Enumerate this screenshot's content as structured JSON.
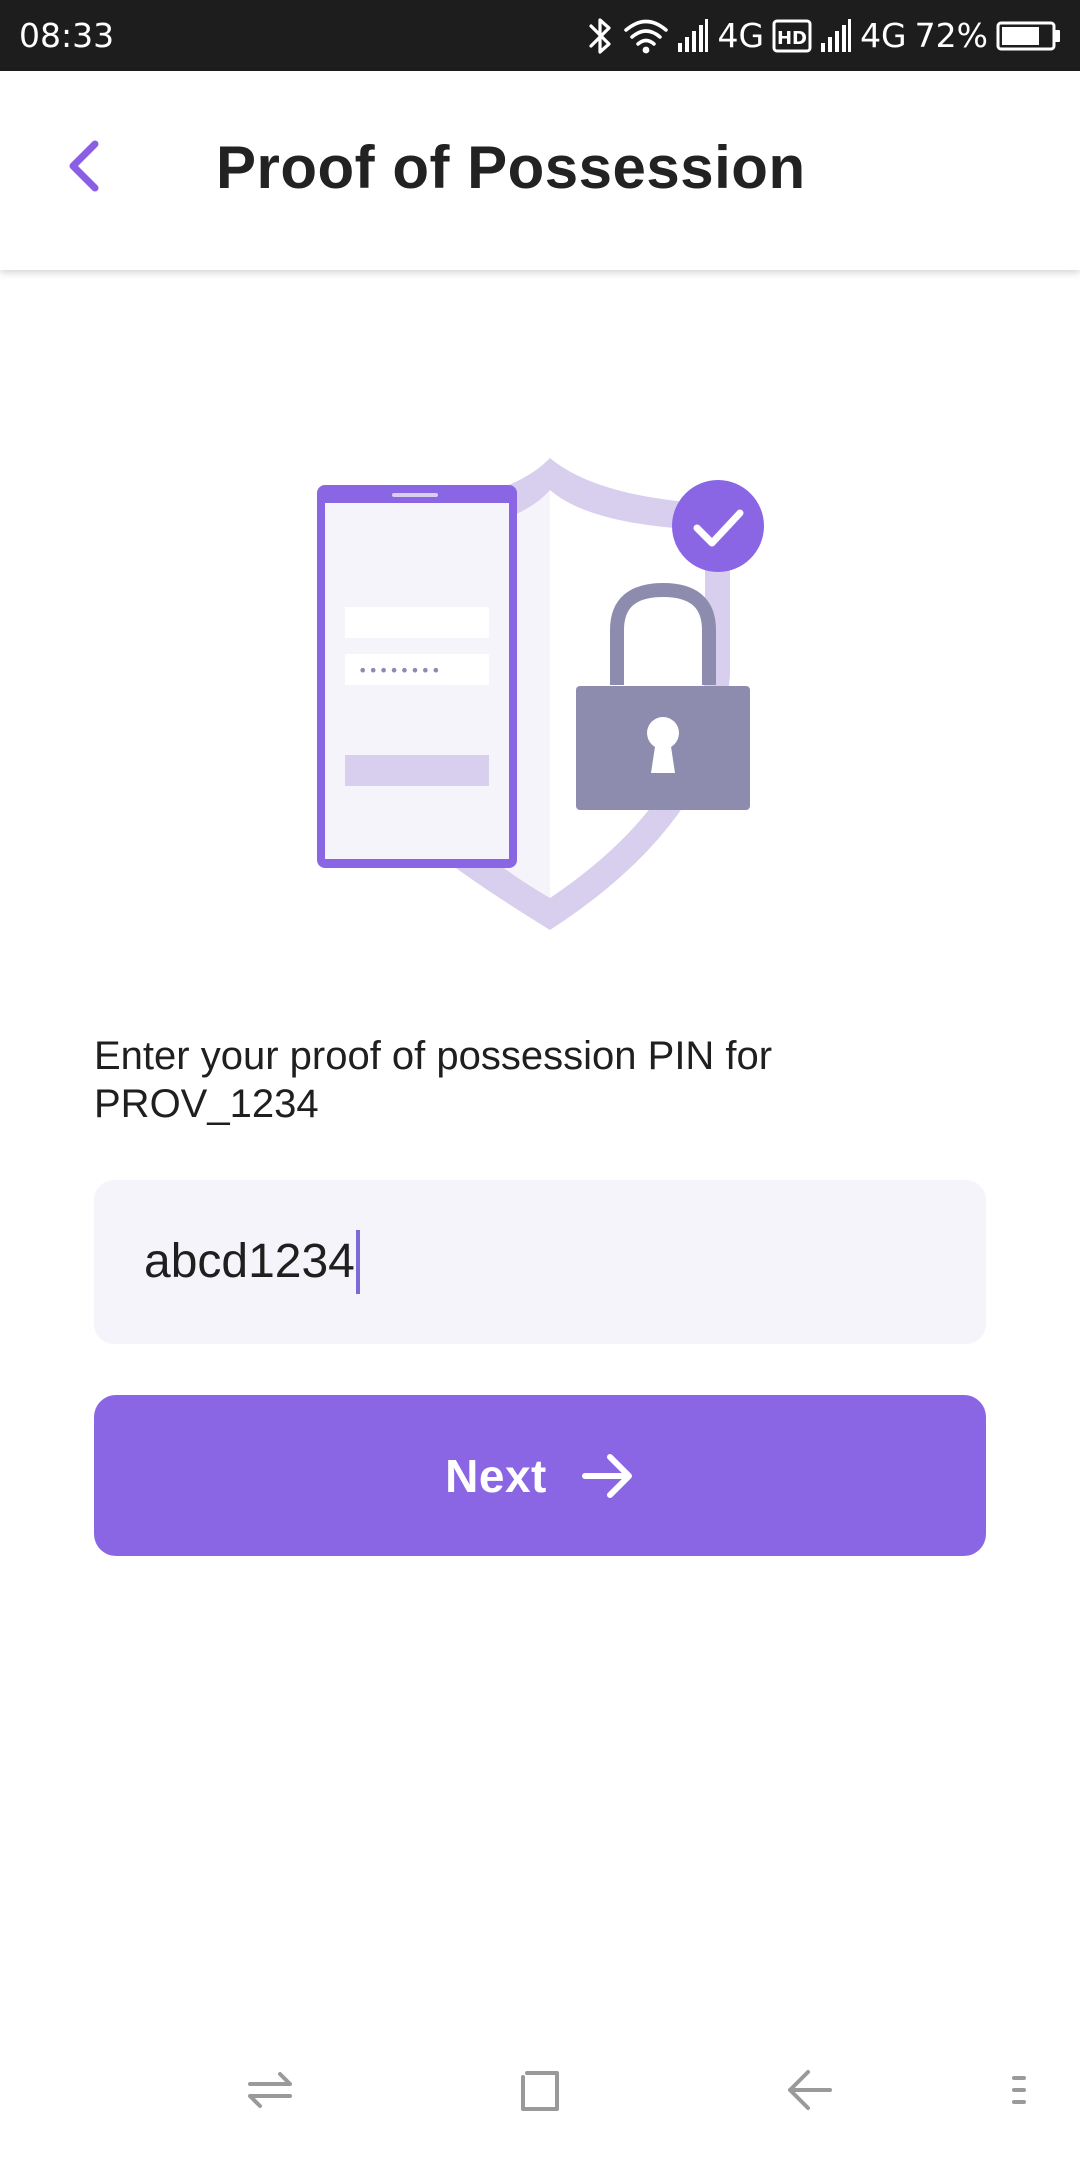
{
  "status_bar": {
    "time": "08:33",
    "network_1": "4G",
    "network_2": "4G",
    "battery": "72%",
    "icons": [
      "bluetooth-icon",
      "wifi-icon",
      "signal-icon",
      "hd-icon",
      "signal-icon",
      "battery-icon"
    ]
  },
  "header": {
    "title": "Proof of Possession",
    "back_icon": "chevron-left-icon"
  },
  "illustration": {
    "icons": [
      "phone-icon",
      "shield-icon",
      "check-badge-icon",
      "padlock-icon"
    ],
    "masked_password": "••••••••"
  },
  "form": {
    "prompt": "Enter your proof of possession PIN for PROV_1234",
    "pin_value": "abcd1234",
    "next_label": "Next",
    "next_icon": "arrow-right-icon"
  },
  "navigation": {
    "items": [
      "switch-apps-icon",
      "home-icon",
      "back-icon",
      "menu-icon"
    ]
  },
  "colors": {
    "accent": "#8a66e4",
    "status_bar_bg": "#1d1d1d",
    "input_bg": "#f5f4fa",
    "padlock": "#8e8cae",
    "shield": "#d8cfee"
  }
}
